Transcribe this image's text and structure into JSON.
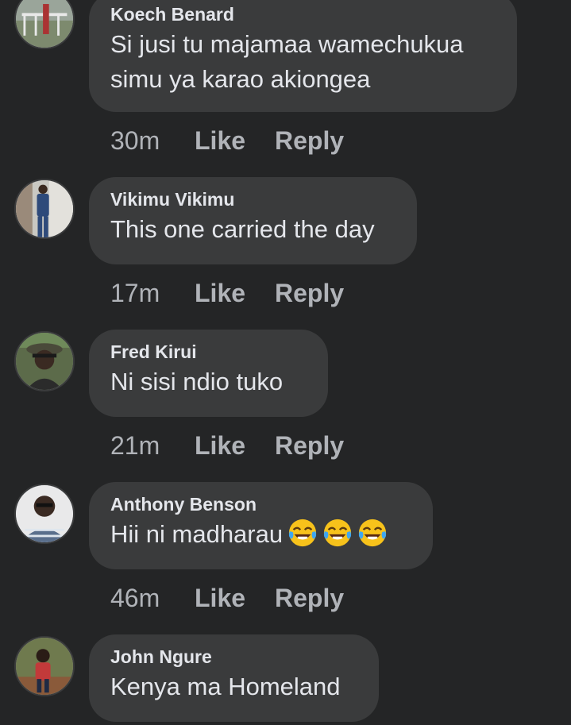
{
  "comments": [
    {
      "author": "Koech Benard",
      "text": "Si jusi tu majamaa wamechukua simu ya karao  akiongea",
      "time": "30m",
      "like_label": "Like",
      "reply_label": "Reply"
    },
    {
      "author": "Vikimu Vikimu",
      "text": "This one carried the day",
      "time": "17m",
      "like_label": "Like",
      "reply_label": "Reply"
    },
    {
      "author": "Fred Kirui",
      "text": "Ni sisi ndio tuko",
      "time": "21m",
      "like_label": "Like",
      "reply_label": "Reply"
    },
    {
      "author": "Anthony Benson",
      "text": "Hii ni madharau",
      "emojis": [
        "tears-of-joy-emoji",
        "tears-of-joy-emoji",
        "tears-of-joy-emoji"
      ],
      "time": "46m",
      "like_label": "Like",
      "reply_label": "Reply"
    },
    {
      "author": "John Ngure",
      "text": "Kenya ma Homeland"
    }
  ],
  "colors": {
    "background": "#242526",
    "bubble": "#3a3b3c",
    "primary_text": "#e4e6eb",
    "secondary_text": "#b0b3b8"
  }
}
